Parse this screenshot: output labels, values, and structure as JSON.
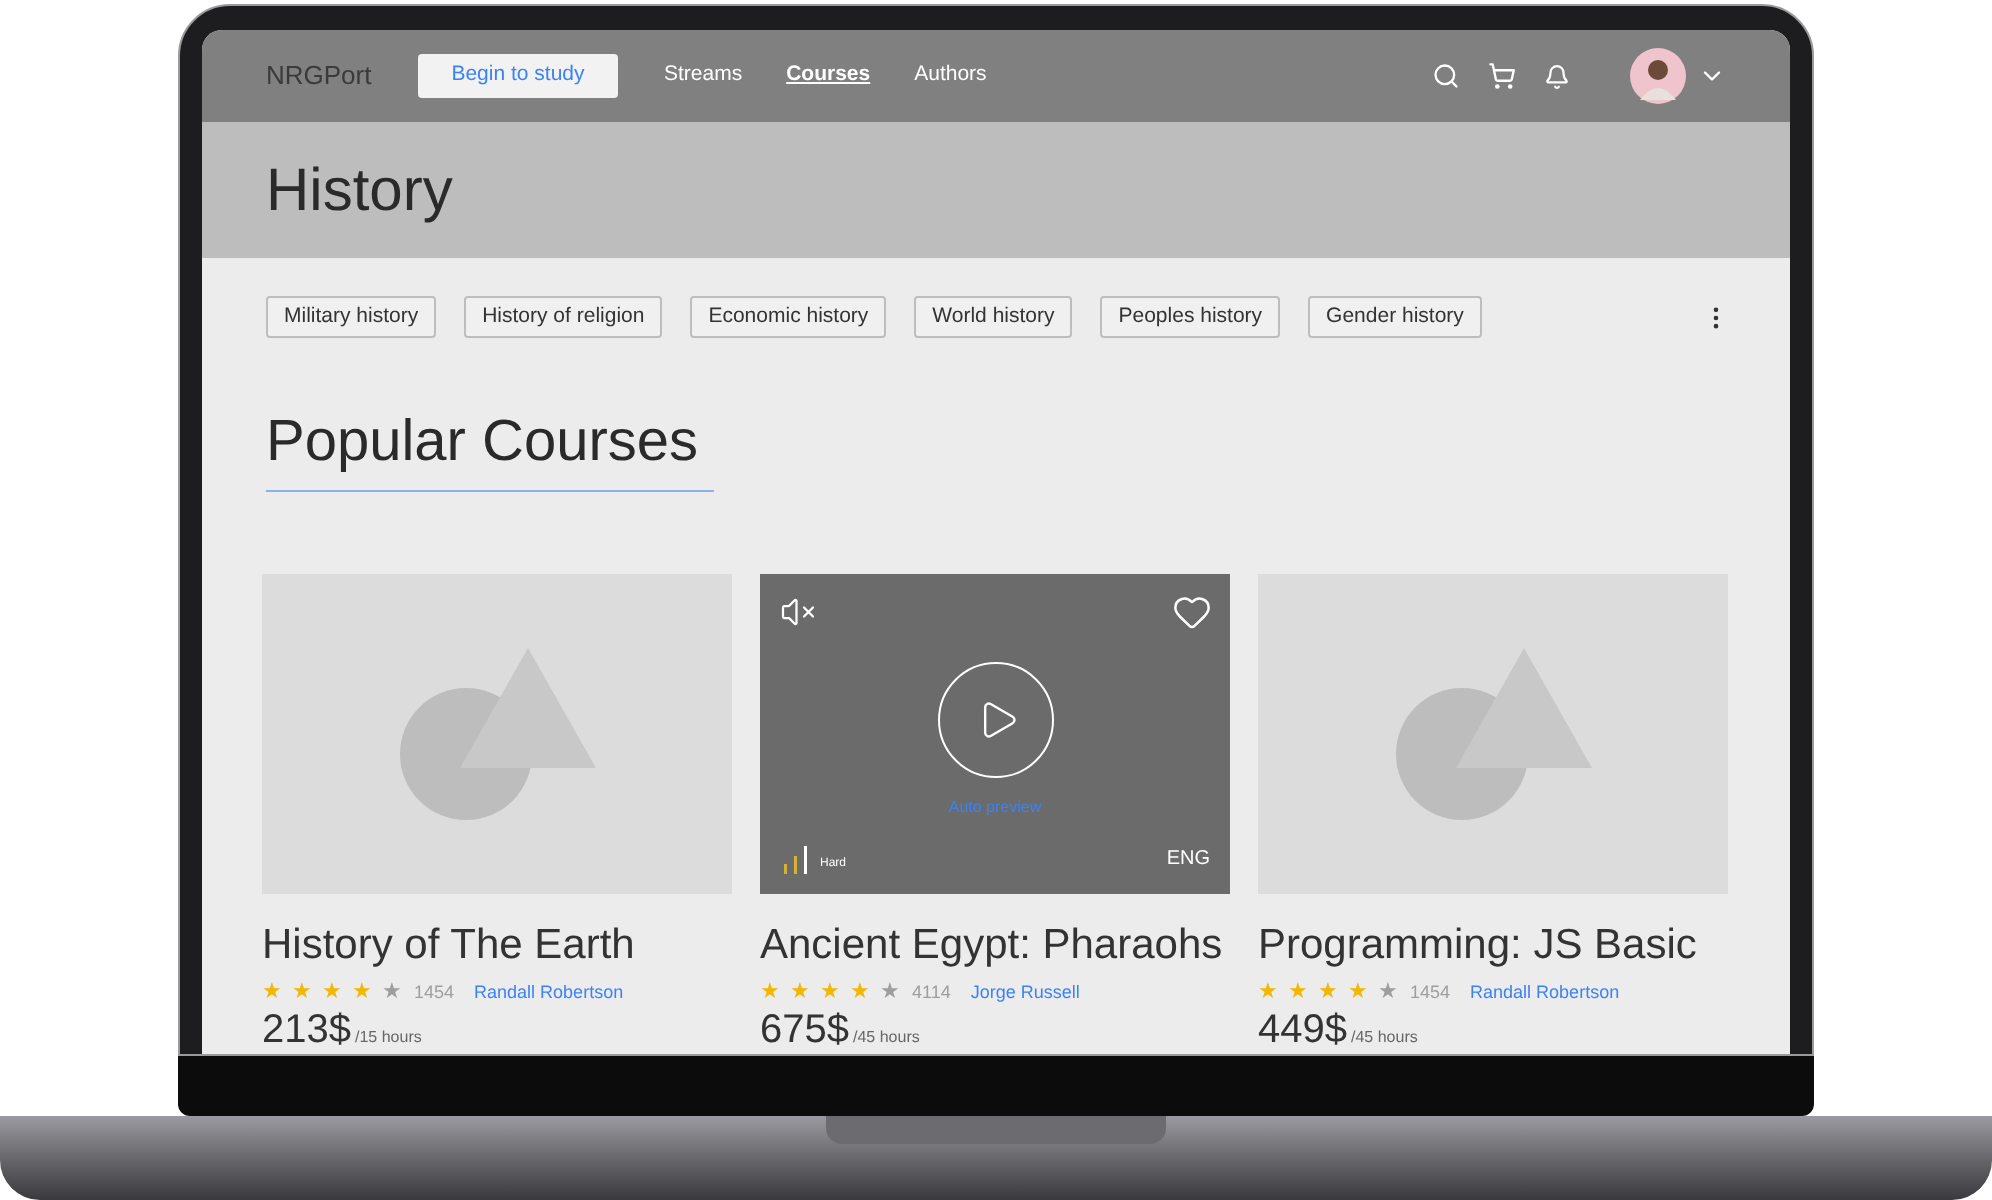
{
  "navbar": {
    "logo": "NRGPort",
    "cta": "Begin to study",
    "links": [
      {
        "label": "Streams",
        "selected": false
      },
      {
        "label": "Courses",
        "selected": true
      },
      {
        "label": "Authors",
        "selected": false
      }
    ]
  },
  "header": {
    "title": "History"
  },
  "categories": [
    "Military history",
    "History of religion",
    "Economic history",
    "World history",
    "Peoples history",
    "Gender history"
  ],
  "section": {
    "title": "Popular Courses"
  },
  "courses": [
    {
      "kind": "placeholder",
      "title": "History of The Earth",
      "stars": 4,
      "reviews": "1454",
      "author": "Randall Robertson",
      "price": "213$",
      "duration": "/15 hours"
    },
    {
      "kind": "video",
      "title": "Ancient Egypt: Pharaohs",
      "stars": 4,
      "reviews": "4114",
      "author": "Jorge Russell",
      "price": "675$",
      "duration": "/45 hours",
      "preview": "Auto preview",
      "difficulty": "Hard",
      "language": "ENG"
    },
    {
      "kind": "placeholder",
      "title": "Programming: JS Basic",
      "stars": 4,
      "reviews": "1454",
      "author": "Randall Robertson",
      "price": "449$",
      "duration": "/45 hours"
    }
  ]
}
